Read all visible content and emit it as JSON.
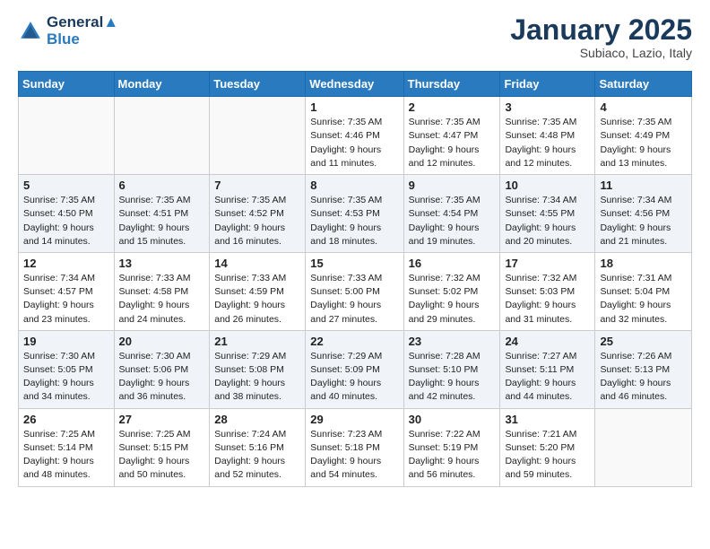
{
  "logo": {
    "line1": "General",
    "line2": "Blue"
  },
  "title": "January 2025",
  "location": "Subiaco, Lazio, Italy",
  "days_of_week": [
    "Sunday",
    "Monday",
    "Tuesday",
    "Wednesday",
    "Thursday",
    "Friday",
    "Saturday"
  ],
  "weeks": [
    [
      {
        "day": "",
        "info": ""
      },
      {
        "day": "",
        "info": ""
      },
      {
        "day": "",
        "info": ""
      },
      {
        "day": "1",
        "info": "Sunrise: 7:35 AM\nSunset: 4:46 PM\nDaylight: 9 hours\nand 11 minutes."
      },
      {
        "day": "2",
        "info": "Sunrise: 7:35 AM\nSunset: 4:47 PM\nDaylight: 9 hours\nand 12 minutes."
      },
      {
        "day": "3",
        "info": "Sunrise: 7:35 AM\nSunset: 4:48 PM\nDaylight: 9 hours\nand 12 minutes."
      },
      {
        "day": "4",
        "info": "Sunrise: 7:35 AM\nSunset: 4:49 PM\nDaylight: 9 hours\nand 13 minutes."
      }
    ],
    [
      {
        "day": "5",
        "info": "Sunrise: 7:35 AM\nSunset: 4:50 PM\nDaylight: 9 hours\nand 14 minutes."
      },
      {
        "day": "6",
        "info": "Sunrise: 7:35 AM\nSunset: 4:51 PM\nDaylight: 9 hours\nand 15 minutes."
      },
      {
        "day": "7",
        "info": "Sunrise: 7:35 AM\nSunset: 4:52 PM\nDaylight: 9 hours\nand 16 minutes."
      },
      {
        "day": "8",
        "info": "Sunrise: 7:35 AM\nSunset: 4:53 PM\nDaylight: 9 hours\nand 18 minutes."
      },
      {
        "day": "9",
        "info": "Sunrise: 7:35 AM\nSunset: 4:54 PM\nDaylight: 9 hours\nand 19 minutes."
      },
      {
        "day": "10",
        "info": "Sunrise: 7:34 AM\nSunset: 4:55 PM\nDaylight: 9 hours\nand 20 minutes."
      },
      {
        "day": "11",
        "info": "Sunrise: 7:34 AM\nSunset: 4:56 PM\nDaylight: 9 hours\nand 21 minutes."
      }
    ],
    [
      {
        "day": "12",
        "info": "Sunrise: 7:34 AM\nSunset: 4:57 PM\nDaylight: 9 hours\nand 23 minutes."
      },
      {
        "day": "13",
        "info": "Sunrise: 7:33 AM\nSunset: 4:58 PM\nDaylight: 9 hours\nand 24 minutes."
      },
      {
        "day": "14",
        "info": "Sunrise: 7:33 AM\nSunset: 4:59 PM\nDaylight: 9 hours\nand 26 minutes."
      },
      {
        "day": "15",
        "info": "Sunrise: 7:33 AM\nSunset: 5:00 PM\nDaylight: 9 hours\nand 27 minutes."
      },
      {
        "day": "16",
        "info": "Sunrise: 7:32 AM\nSunset: 5:02 PM\nDaylight: 9 hours\nand 29 minutes."
      },
      {
        "day": "17",
        "info": "Sunrise: 7:32 AM\nSunset: 5:03 PM\nDaylight: 9 hours\nand 31 minutes."
      },
      {
        "day": "18",
        "info": "Sunrise: 7:31 AM\nSunset: 5:04 PM\nDaylight: 9 hours\nand 32 minutes."
      }
    ],
    [
      {
        "day": "19",
        "info": "Sunrise: 7:30 AM\nSunset: 5:05 PM\nDaylight: 9 hours\nand 34 minutes."
      },
      {
        "day": "20",
        "info": "Sunrise: 7:30 AM\nSunset: 5:06 PM\nDaylight: 9 hours\nand 36 minutes."
      },
      {
        "day": "21",
        "info": "Sunrise: 7:29 AM\nSunset: 5:08 PM\nDaylight: 9 hours\nand 38 minutes."
      },
      {
        "day": "22",
        "info": "Sunrise: 7:29 AM\nSunset: 5:09 PM\nDaylight: 9 hours\nand 40 minutes."
      },
      {
        "day": "23",
        "info": "Sunrise: 7:28 AM\nSunset: 5:10 PM\nDaylight: 9 hours\nand 42 minutes."
      },
      {
        "day": "24",
        "info": "Sunrise: 7:27 AM\nSunset: 5:11 PM\nDaylight: 9 hours\nand 44 minutes."
      },
      {
        "day": "25",
        "info": "Sunrise: 7:26 AM\nSunset: 5:13 PM\nDaylight: 9 hours\nand 46 minutes."
      }
    ],
    [
      {
        "day": "26",
        "info": "Sunrise: 7:25 AM\nSunset: 5:14 PM\nDaylight: 9 hours\nand 48 minutes."
      },
      {
        "day": "27",
        "info": "Sunrise: 7:25 AM\nSunset: 5:15 PM\nDaylight: 9 hours\nand 50 minutes."
      },
      {
        "day": "28",
        "info": "Sunrise: 7:24 AM\nSunset: 5:16 PM\nDaylight: 9 hours\nand 52 minutes."
      },
      {
        "day": "29",
        "info": "Sunrise: 7:23 AM\nSunset: 5:18 PM\nDaylight: 9 hours\nand 54 minutes."
      },
      {
        "day": "30",
        "info": "Sunrise: 7:22 AM\nSunset: 5:19 PM\nDaylight: 9 hours\nand 56 minutes."
      },
      {
        "day": "31",
        "info": "Sunrise: 7:21 AM\nSunset: 5:20 PM\nDaylight: 9 hours\nand 59 minutes."
      },
      {
        "day": "",
        "info": ""
      }
    ]
  ]
}
